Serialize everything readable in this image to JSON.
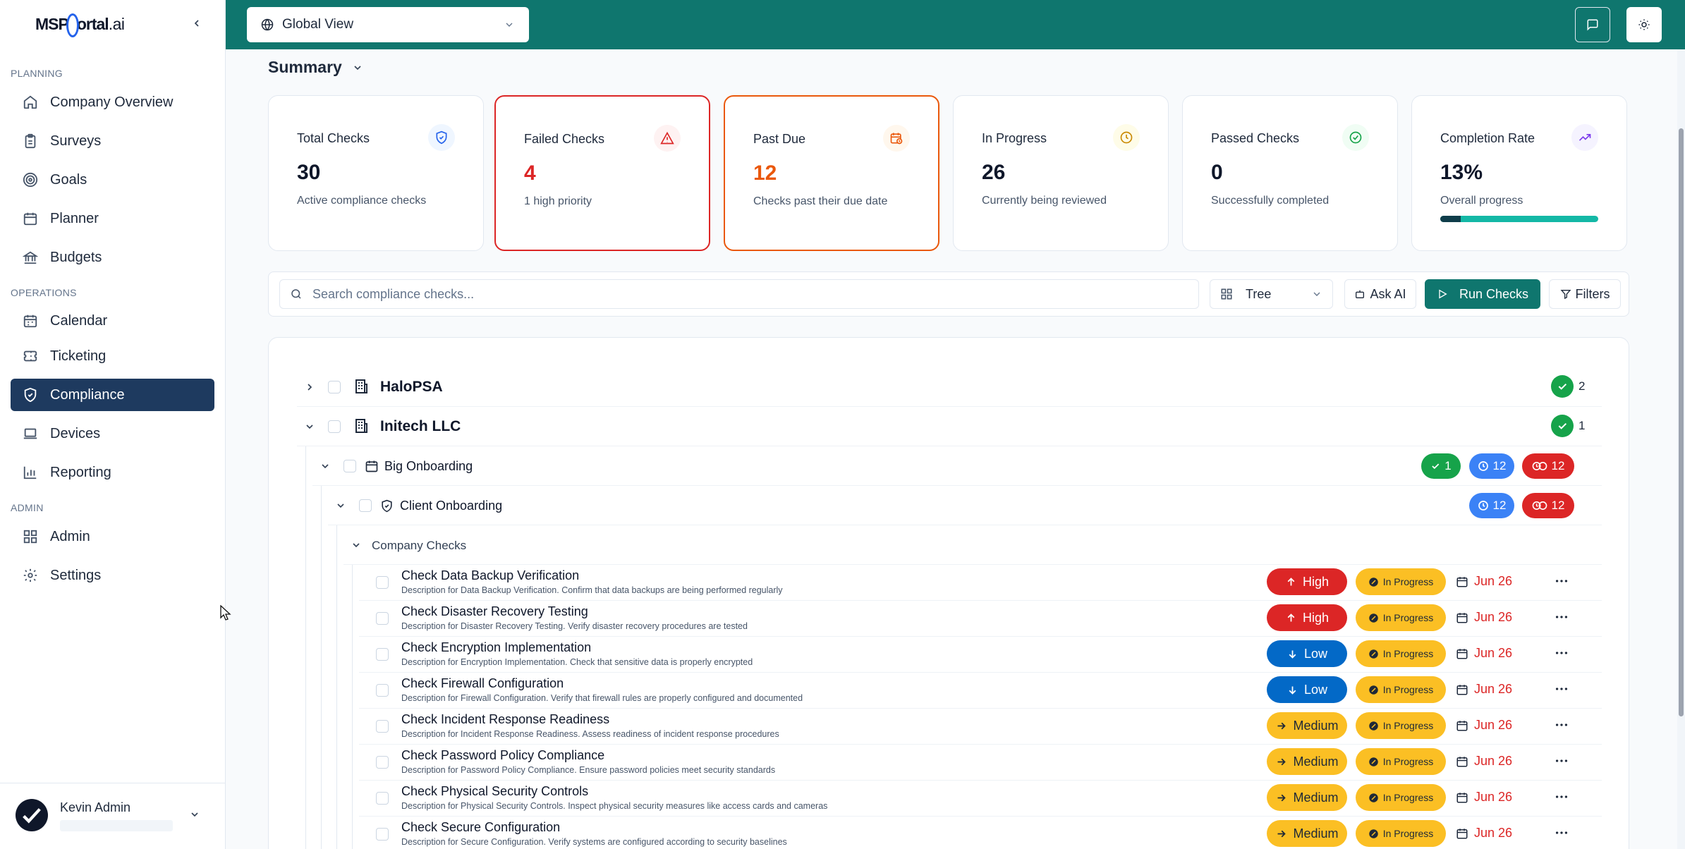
{
  "brand": {
    "name_a": "MSP",
    "name_b": "ortal",
    "name_c": ".ai"
  },
  "sidebar": {
    "sections": [
      {
        "label": "PLANNING",
        "items": [
          {
            "label": "Company Overview",
            "icon": "home-icon"
          },
          {
            "label": "Surveys",
            "icon": "clipboard-icon"
          },
          {
            "label": "Goals",
            "icon": "target-icon"
          },
          {
            "label": "Planner",
            "icon": "calendar-icon"
          },
          {
            "label": "Budgets",
            "icon": "bank-icon"
          }
        ]
      },
      {
        "label": "OPERATIONS",
        "items": [
          {
            "label": "Calendar",
            "icon": "calendar-icon"
          },
          {
            "label": "Ticketing",
            "icon": "ticket-icon"
          },
          {
            "label": "Compliance",
            "icon": "shield-check-icon",
            "active": true
          },
          {
            "label": "Devices",
            "icon": "laptop-icon"
          },
          {
            "label": "Reporting",
            "icon": "bar-chart-icon"
          }
        ]
      },
      {
        "label": "ADMIN",
        "items": [
          {
            "label": "Admin",
            "icon": "grid-icon"
          },
          {
            "label": "Settings",
            "icon": "gear-icon"
          }
        ]
      }
    ],
    "user": {
      "name": "Kevin Admin"
    }
  },
  "topbar": {
    "view_selector": "Global View",
    "icons": [
      "message-square-icon",
      "sun-icon"
    ]
  },
  "summary": {
    "title": "Summary",
    "cards": [
      {
        "label": "Total Checks",
        "value": "30",
        "sub": "Active compliance checks",
        "icon": "shield-icon",
        "color": "#2563eb"
      },
      {
        "label": "Failed Checks",
        "value": "4",
        "sub": "1 high priority",
        "icon": "alert-triangle-icon",
        "color": "#dc2626"
      },
      {
        "label": "Past Due",
        "value": "12",
        "sub": "Checks past their due date",
        "icon": "calendar-clock-icon",
        "color": "#ea580c"
      },
      {
        "label": "In Progress",
        "value": "26",
        "sub": "Currently being reviewed",
        "icon": "clock-icon",
        "color": "#ca8a04"
      },
      {
        "label": "Passed Checks",
        "value": "0",
        "sub": "Successfully completed",
        "icon": "check-circle-icon",
        "color": "#16a34a"
      },
      {
        "label": "Completion Rate",
        "value": "13%",
        "sub": "Overall progress",
        "icon": "trending-up-icon",
        "color": "#7c3aed",
        "progress": 0.13
      }
    ]
  },
  "toolbar": {
    "search_placeholder": "Search compliance checks...",
    "view_mode": "Tree",
    "ask_ai": "Ask AI",
    "run_checks": "Run Checks",
    "filters": "Filters"
  },
  "tree": {
    "companies": [
      {
        "name": "HaloPSA",
        "passed": "2",
        "expanded": false
      },
      {
        "name": "Initech LLC",
        "passed": "1",
        "expanded": true
      }
    ],
    "project": {
      "name": "Big Onboarding",
      "passed": "1",
      "in_progress": "12",
      "overdue": "12"
    },
    "framework": {
      "name": "Client Onboarding",
      "in_progress": "12",
      "overdue": "12"
    },
    "group": {
      "name": "Company Checks"
    },
    "checks": [
      {
        "title": "Check Data Backup Verification",
        "desc": "Description for Data Backup Verification. Confirm that data backups are being performed regularly",
        "priority": "High",
        "status": "In Progress",
        "due": "Jun 26"
      },
      {
        "title": "Check Disaster Recovery Testing",
        "desc": "Description for Disaster Recovery Testing. Verify disaster recovery procedures are tested",
        "priority": "High",
        "status": "In Progress",
        "due": "Jun 26"
      },
      {
        "title": "Check Encryption Implementation",
        "desc": "Description for Encryption Implementation. Check that sensitive data is properly encrypted",
        "priority": "Low",
        "status": "In Progress",
        "due": "Jun 26"
      },
      {
        "title": "Check Firewall Configuration",
        "desc": "Description for Firewall Configuration. Verify that firewall rules are properly configured and documented",
        "priority": "Low",
        "status": "In Progress",
        "due": "Jun 26"
      },
      {
        "title": "Check Incident Response Readiness",
        "desc": "Description for Incident Response Readiness. Assess readiness of incident response procedures",
        "priority": "Medium",
        "status": "In Progress",
        "due": "Jun 26"
      },
      {
        "title": "Check Password Policy Compliance",
        "desc": "Description for Password Policy Compliance. Ensure password policies meet security standards",
        "priority": "Medium",
        "status": "In Progress",
        "due": "Jun 26"
      },
      {
        "title": "Check Physical Security Controls",
        "desc": "Description for Physical Security Controls. Inspect physical security measures like access cards and cameras",
        "priority": "Medium",
        "status": "In Progress",
        "due": "Jun 26"
      },
      {
        "title": "Check Secure Configuration",
        "desc": "Description for Secure Configuration. Verify systems are configured according to security baselines",
        "priority": "Medium",
        "status": "In Progress",
        "due": "Jun 26"
      }
    ]
  }
}
